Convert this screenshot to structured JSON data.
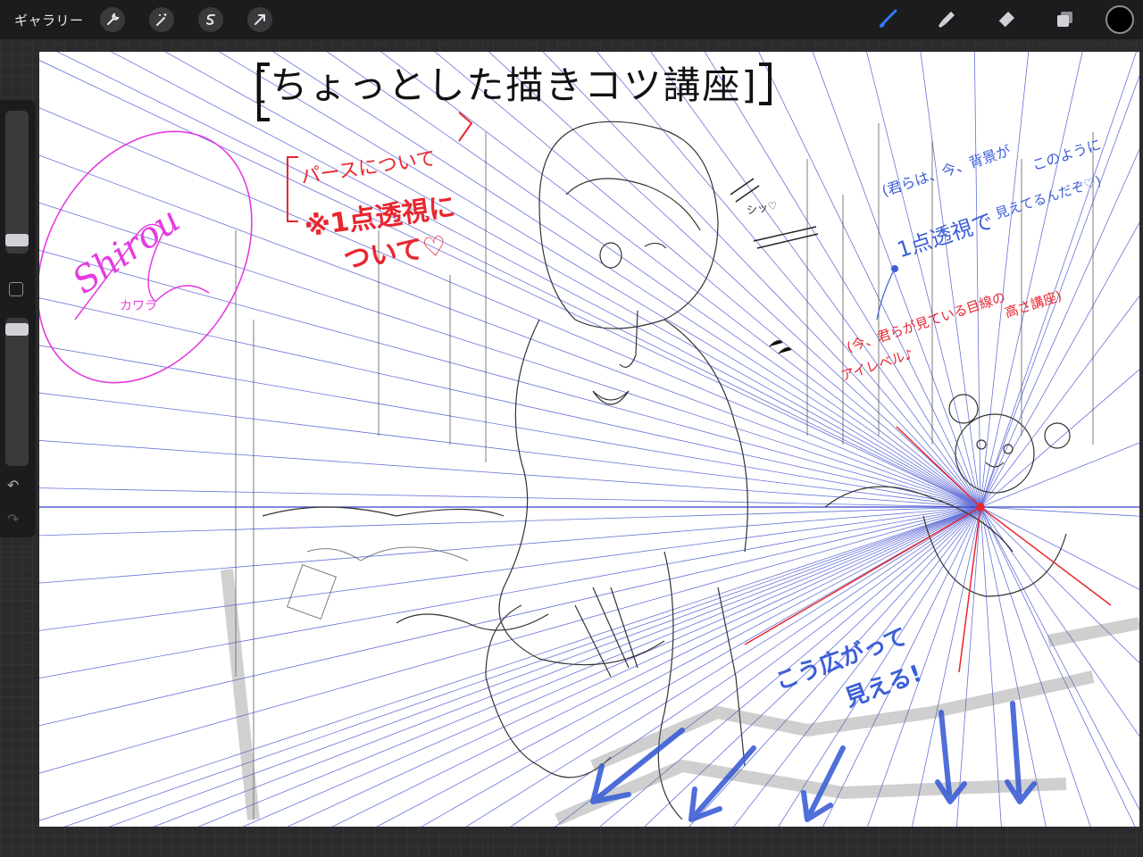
{
  "app": {
    "gallery_label": "ギャラリー"
  },
  "toolbar_left": [
    {
      "name": "actions-wrench-icon"
    },
    {
      "name": "adjustments-wand-icon"
    },
    {
      "name": "selection-icon"
    },
    {
      "name": "transform-arrow-icon"
    }
  ],
  "toolbar_right": [
    {
      "name": "brush-icon",
      "active": true
    },
    {
      "name": "smudge-icon",
      "active": false
    },
    {
      "name": "eraser-icon",
      "active": false
    },
    {
      "name": "layers-icon",
      "active": false
    }
  ],
  "colors": {
    "active_tool": "#2f7cf6",
    "current_color": "#000000",
    "perspective_guide": "#3344cc",
    "annotation_red": "#e8262f",
    "annotation_blue": "#3c5fd6",
    "annotation_magenta": "#e43ce0"
  },
  "sidebar": {
    "brush_size_level": 0.55,
    "opacity_level": 0.05,
    "undo_icon": "undo-icon",
    "redo_icon": "redo-icon"
  },
  "artwork": {
    "title": "[ちょっとした描きコツ講座]",
    "pass_label": "パースについて",
    "one_point_label": "※1点透視に",
    "one_point_label2": "ついて♡",
    "shh_label": "シッ♡",
    "blue_note_1": "(君らは、今、背景が",
    "blue_note_2": "このように",
    "blue_note_3": "1点透視で",
    "blue_note_4": "見えてるんだぞ♡)",
    "red_note_1": "(今、君らが見ている目線の",
    "red_note_2": "高さ講座)",
    "red_note_3": "アイレベル♪",
    "spread_label_1": "こう広がって",
    "spread_label_2": "見える!",
    "signature": "Shirou",
    "signature_sub": "カワラ"
  }
}
